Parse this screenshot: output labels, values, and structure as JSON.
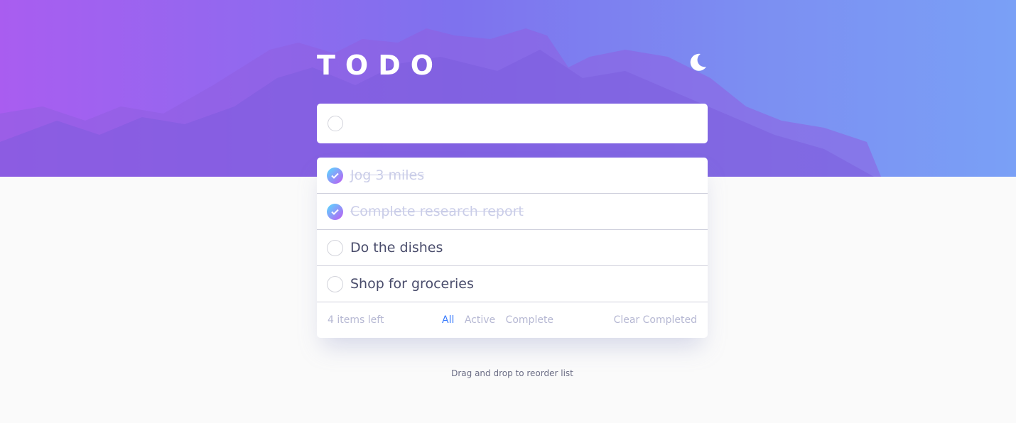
{
  "app": {
    "title": "TODO",
    "theme_icon": "moon-icon"
  },
  "new_todo": {
    "placeholder": "",
    "value": ""
  },
  "todos": [
    {
      "text": "Jog 3 miles",
      "completed": true
    },
    {
      "text": "Complete research report",
      "completed": true
    },
    {
      "text": "Do the dishes",
      "completed": false
    },
    {
      "text": "Shop for groceries",
      "completed": false
    }
  ],
  "footer": {
    "items_left": "4 items left",
    "filters": {
      "all": "All",
      "active": "Active",
      "complete": "Complete"
    },
    "selected_filter": "All",
    "clear_completed": "Clear Completed"
  },
  "hint": "Drag and drop to reorder list",
  "colors": {
    "accent": "#3a7cfd",
    "check_gradient_start": "#55ddff",
    "check_gradient_end": "#c058f3"
  }
}
